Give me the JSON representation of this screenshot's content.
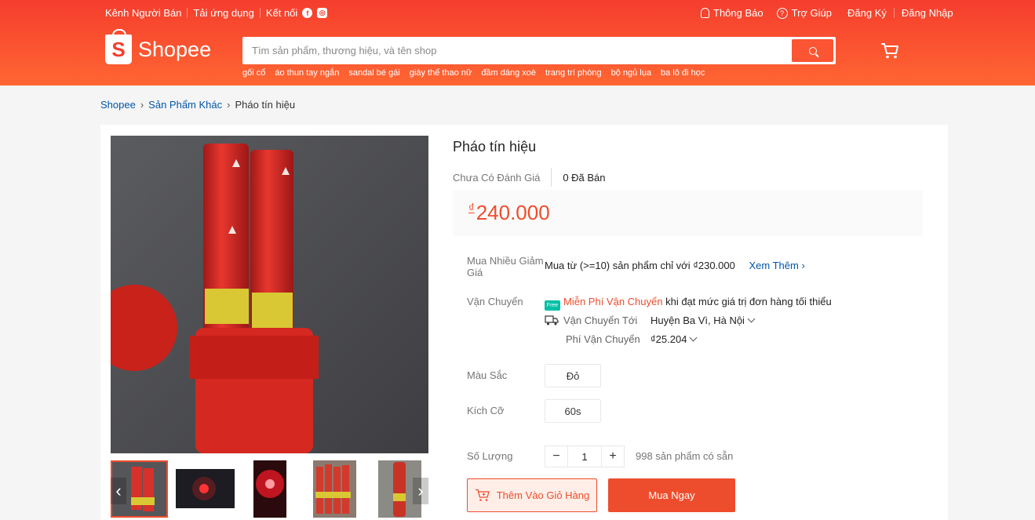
{
  "topbar": {
    "seller_channel": "Kênh Người Bán",
    "download_app": "Tải ứng dụng",
    "connect": "Kết nối",
    "notifications": "Thông Báo",
    "help": "Trợ Giúp",
    "register": "Đăng Ký",
    "login": "Đăng Nhập"
  },
  "logo": {
    "text": "Shopee",
    "mark": "S"
  },
  "search": {
    "placeholder": "Tìm sản phẩm, thương hiệu, và tên shop",
    "suggestions": [
      "gối cổ",
      "áo thun tay ngắn",
      "sandal bé gái",
      "giày thể thao nữ",
      "đầm dáng xoè",
      "trang trí phòng",
      "bộ ngủ lụa",
      "ba lô đi học"
    ]
  },
  "breadcrumb": [
    "Shopee",
    "Sản Phẩm Khác",
    "Pháo tín hiệu"
  ],
  "product": {
    "title": "Pháo tín hiệu",
    "rating": "Chưa Có Đánh Giá",
    "sold": "0 Đã Bán",
    "currency": "₫",
    "price": "240.000",
    "bulk_label": "Mua Nhiều Giảm Giá",
    "bulk_text": "Mua từ (>=10) sản phẩm chỉ với ₫230.000",
    "see_more": "Xem Thêm",
    "shipping_label": "Vận Chuyển",
    "free_badge": "Free",
    "free_shipping": "Miễn Phí Vận Chuyển",
    "free_shipping_cond": "khi đạt mức giá trị đơn hàng tối thiểu",
    "ship_to_label": "Vận Chuyển Tới",
    "ship_to": "Huyện Ba Vì, Hà Nội",
    "ship_fee_label": "Phí Vận Chuyển",
    "ship_fee": "₫25.204",
    "color_label": "Màu Sắc",
    "color_option": "Đỏ",
    "size_label": "Kích Cỡ",
    "size_option": "60s",
    "qty_label": "Số Lượng",
    "qty": "1",
    "qty_minus": "−",
    "qty_plus": "+",
    "available": "998 sản phẩm có sẵn",
    "add_to_cart": "Thêm Vào Giỏ Hàng",
    "buy_now": "Mua Ngay"
  },
  "colors": {
    "brand": "#ee4d2d",
    "link": "#0055aa"
  }
}
